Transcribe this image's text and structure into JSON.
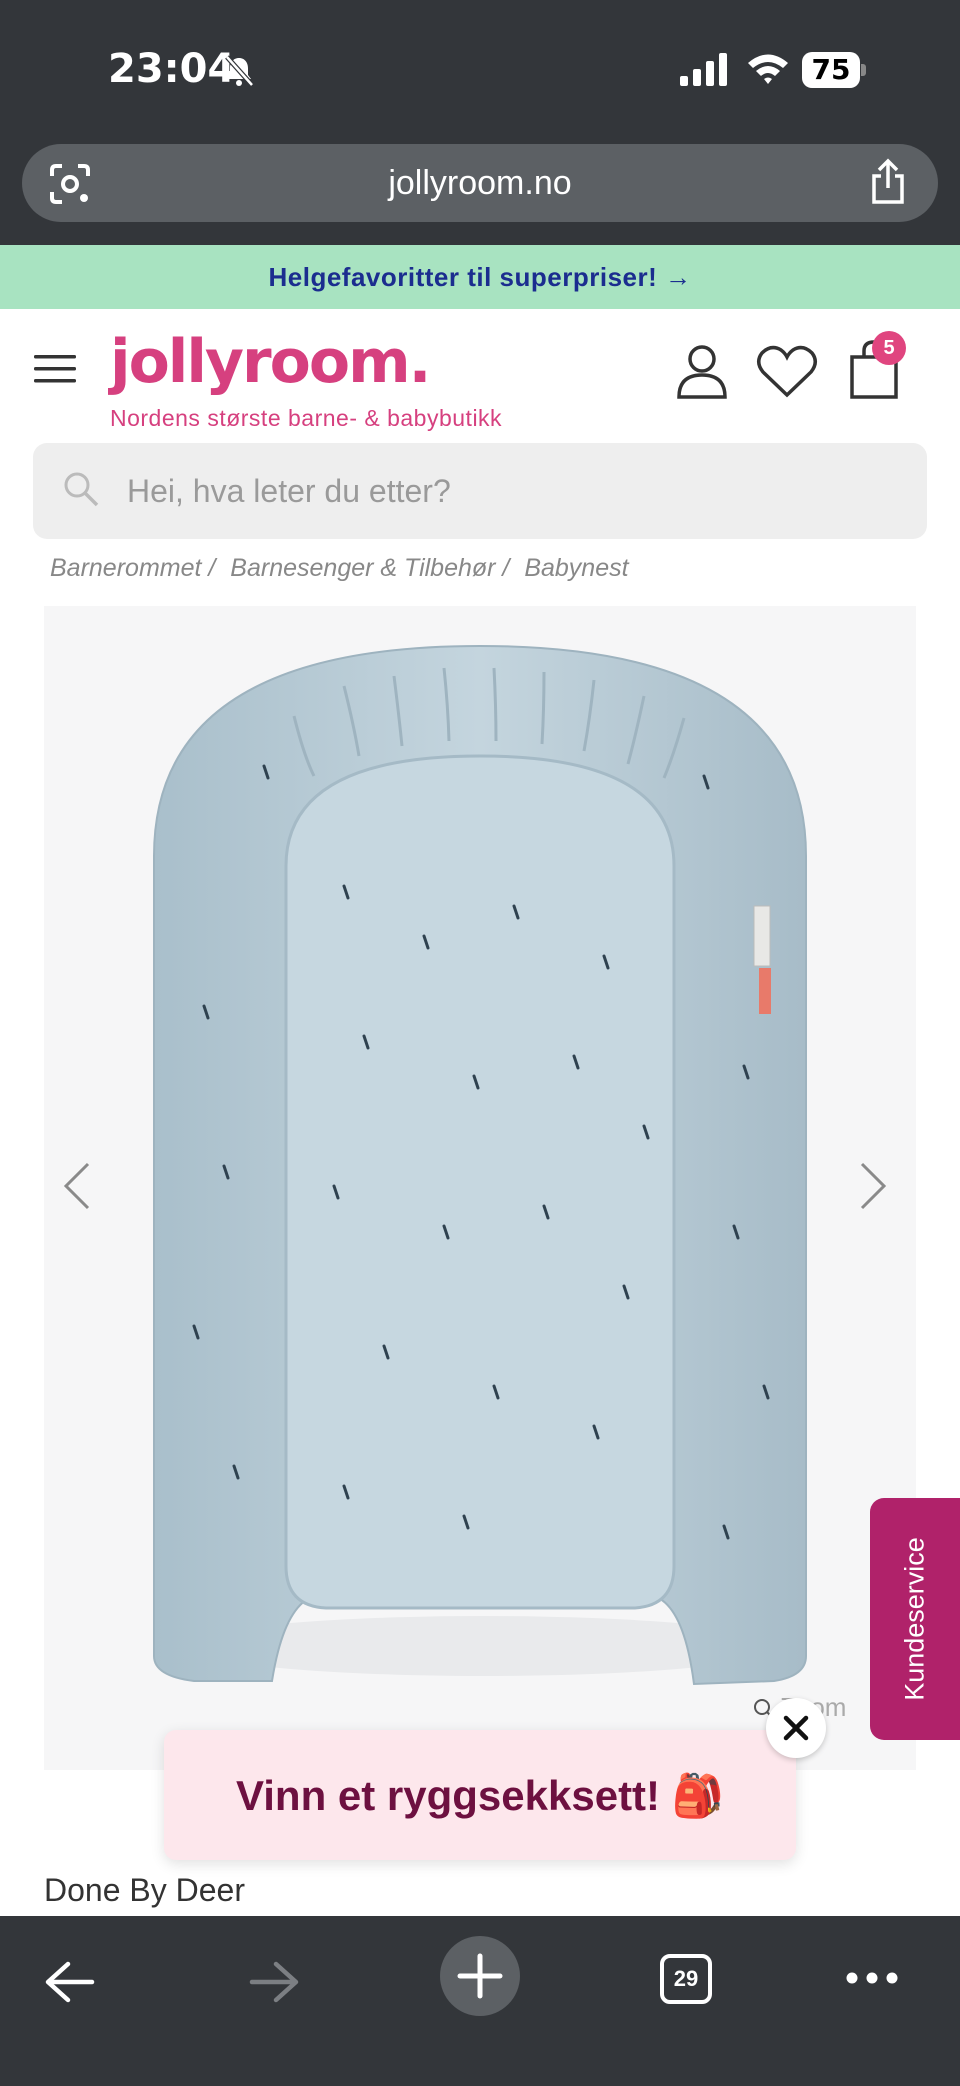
{
  "status_bar": {
    "time": "23:04",
    "battery": "75",
    "icons": [
      "bell-slash-icon",
      "signal-icon",
      "wifi-icon",
      "battery-icon"
    ]
  },
  "browser": {
    "url": "jollyroom.no",
    "icons": [
      "google-lens-icon",
      "share-icon"
    ]
  },
  "promo_banner": {
    "text": "Helgefavoritter til superpriser! →",
    "background": "#a8e3c1",
    "text_color": "#1b2d8f"
  },
  "header": {
    "logo": "jollyroom.",
    "tagline": "Nordens største barne- & babybutikk",
    "cart_count": "5",
    "brand_color": "#d6407f",
    "icons": [
      "menu-icon",
      "user-icon",
      "heart-icon",
      "bag-icon"
    ]
  },
  "search": {
    "placeholder": "Hei, hva leter du etter?"
  },
  "breadcrumb": {
    "items": [
      "Barnerommet /",
      "Barnesenger & Tilbehør /",
      "Babynest"
    ]
  },
  "gallery": {
    "zoom_label": "Zoom",
    "product_color": "#b9ccd6",
    "icons": [
      "chevron-left-icon",
      "chevron-right-icon",
      "zoom-icon"
    ]
  },
  "customer_service": {
    "label": "Kundeservice",
    "color": "#b0226a"
  },
  "popup": {
    "text": "Vinn et ryggsekksett! 🎒",
    "text_color": "#6d1040",
    "background": "#fde7ec"
  },
  "product": {
    "brand": "Done By Deer"
  },
  "toolbar": {
    "tab_count": "29",
    "icons": [
      "back-arrow-icon",
      "forward-arrow-icon",
      "plus-icon",
      "tabs-icon",
      "more-icon"
    ]
  }
}
